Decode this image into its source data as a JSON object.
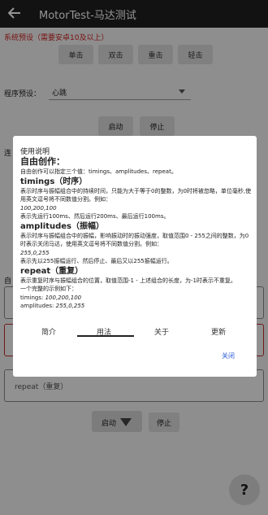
{
  "appbar": {
    "title": "MotorTest-马达测试"
  },
  "warning": "系统预设（需要安卓10及以上）",
  "effect_buttons": [
    "单击",
    "双击",
    "重击",
    "轻击"
  ],
  "preset": {
    "label": "程序预设：",
    "value": "心跳"
  },
  "top_controls": {
    "start": "启动",
    "stop": "停止"
  },
  "side_labels": {
    "lian": "连",
    "zi": "自"
  },
  "repeat_field": {
    "label": "repeat（重复）"
  },
  "bottom_controls": {
    "start": "启动",
    "stop": "停止"
  },
  "fab": {
    "label": "?"
  },
  "dialog": {
    "title": "使用说明",
    "heading": "自由创作：",
    "intro": "自由创作可以指定三个值：timings、amplitudes、repeat。",
    "timings_title": "timings（时序）",
    "timings_desc": "表示时序与振幅组合中的持续时间，只能为大于等于0的整数，为0时将被忽略，单位毫秒,使用英文逗号将不同数值分割。例如：",
    "timings_example": "100,200,100",
    "timings_explain": "表示先运行100ms、然后运行200ms、最后运行100ms。",
    "amplitudes_title": "amplitudes（振幅）",
    "amplitudes_desc": "表示时序与振幅组合中的振幅，影响振动时的振动强度，取值范围0 - 255之间的整数，为0时表示关闭马达，使用英文逗号将不同数值分割。例如：",
    "amplitudes_example": "255,0,255",
    "amplitudes_explain": "表示先以255振幅运行、然后停止、最后又以255振幅运行。",
    "repeat_title": "repeat（重复）",
    "repeat_desc": "表示重复时序与振幅组合的位置，取值范围-1 - 上述组合的长度，为-1时表示不重复。",
    "full_example_intro": "一个完整的示例如下：",
    "full_timings_key": "timings:",
    "full_timings_val": "100,200,100",
    "full_amplitudes_key": "amplitudes:",
    "full_amplitudes_val": "255,0,255",
    "tabs": [
      "简介",
      "用法",
      "关于",
      "更新"
    ],
    "active_tab": "用法",
    "close": "关闭"
  }
}
